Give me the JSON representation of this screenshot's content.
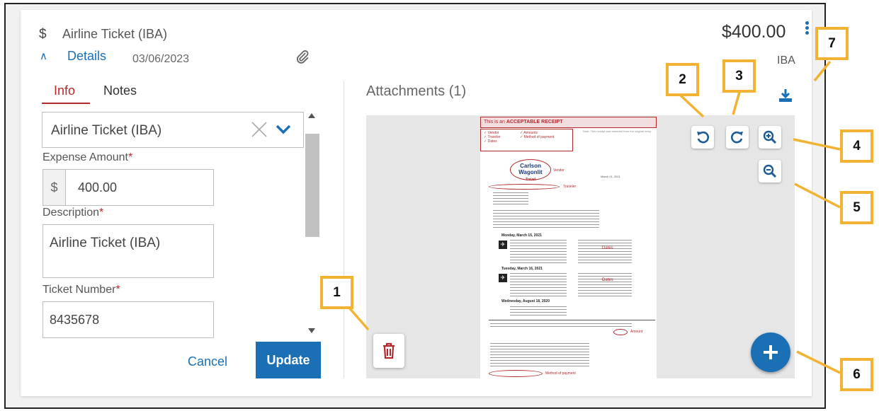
{
  "header": {
    "currency_symbol": "$",
    "expense_title": "Airline Ticket (IBA)",
    "details_toggle": "Details",
    "date": "03/06/2023",
    "amount": "$400.00",
    "org_code": "IBA",
    "icons": {
      "currency": "dollar-icon",
      "toggle": "chevron-up-icon",
      "attachment": "paperclip-icon",
      "menu": "vertical-dots-icon"
    }
  },
  "tabs": [
    {
      "label": "Info",
      "active": true
    },
    {
      "label": "Notes",
      "active": false
    }
  ],
  "form": {
    "expense_type": {
      "value": "Airline Ticket (IBA)"
    },
    "expense_amount": {
      "label": "Expense Amount",
      "required_mark": "*",
      "prefix": "$",
      "value": "400.00"
    },
    "description": {
      "label": "Description",
      "required_mark": "*",
      "value": "Airline Ticket (IBA)"
    },
    "ticket_number": {
      "label": "Ticket Number",
      "required_mark": "*",
      "value": "8435678"
    },
    "cancel_label": "Cancel",
    "update_label": "Update"
  },
  "attachments": {
    "title": "Attachments (1)",
    "receipt": {
      "banner_prefix": "This is an ",
      "banner_strong": "ACCEPTABLE RECEIPT",
      "note": "Note: This receipt was redacted from the original entry.",
      "checklist_left": [
        "✓ Vendor",
        "✓ Traveler",
        "✓ Dates"
      ],
      "checklist_right": [
        "✓ Amounts",
        "✓ Method of payment"
      ],
      "logo_line1": "Carlson",
      "logo_line2": "Wagonlit",
      "logo_line3": "Travel",
      "vendor_label": "Vendor",
      "receipt_date": "March 01, 2021",
      "traveler_label": "Traveler",
      "day1": "Monday, March 15, 2021",
      "day2": "Tuesday, March 16, 2021",
      "day3": "Wednesday, August 18, 2020",
      "dates_label": "Dates",
      "amount_label": "Amount",
      "payment_label": "Method of payment"
    }
  },
  "callouts": [
    "1",
    "2",
    "3",
    "4",
    "5",
    "6",
    "7"
  ],
  "colors": {
    "primary": "#1a6fb5",
    "danger": "#b3282d",
    "callout_border": "#f2b233"
  }
}
